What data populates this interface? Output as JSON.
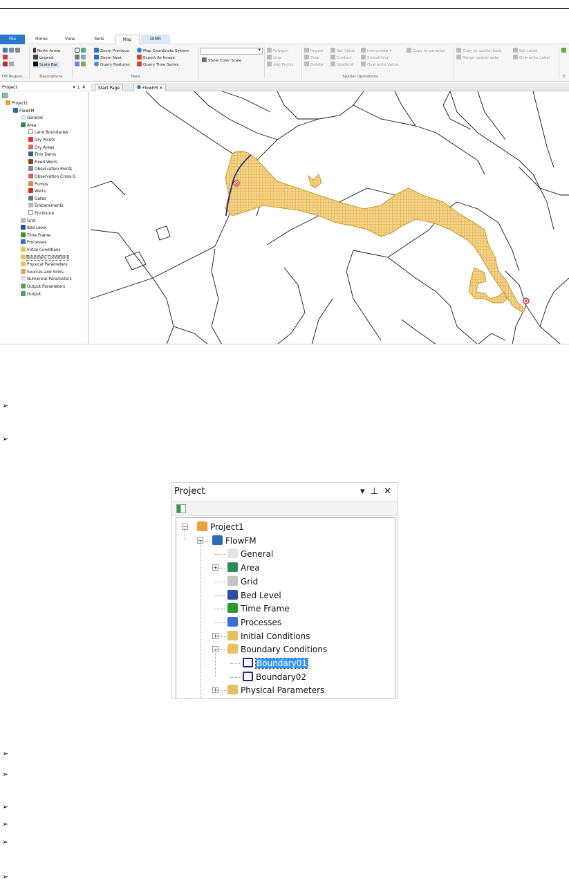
{
  "ribbon": {
    "tabs": [
      "File",
      "Home",
      "View",
      "Tools",
      "Map",
      "DIMR"
    ],
    "fm_region": {
      "buttons": [
        "...",
        "..."
      ],
      "label": "FM Region..."
    },
    "decorations": {
      "label": "Decorations",
      "items": [
        "North Arrow",
        "Legend",
        "Scale Bar"
      ]
    },
    "tools": {
      "label": "Tools",
      "items": [
        "Zoom Previous",
        "Zoom Next",
        "Query Features",
        "Map Coordinate System",
        "Export As Image",
        "Query Time Series"
      ]
    },
    "color_scale": {
      "combo_value": "",
      "button": "Show Color Scale"
    },
    "spatial": {
      "label": "Spatial Operations",
      "geom": [
        "Polygon",
        "Line",
        "Add Points"
      ],
      "edit": [
        "Import",
        "Crop",
        "Delete"
      ],
      "value": [
        "Set Value",
        "Contour",
        "Gradient"
      ],
      "interp": [
        "Interpolate ▾",
        "Smoothing",
        "Overwrite Value"
      ],
      "samples": [
        "Copy to samples"
      ],
      "spatialdata": [
        "Copy to spatial data",
        "Merge spatial data"
      ],
      "labels": [
        "Set Label",
        "Overwrite Label"
      ],
      "trailing": "E"
    }
  },
  "project_panel": {
    "title": "Project",
    "controls": "▾ ⊥ ✕",
    "tree": [
      "Project1",
      "FlowFM",
      "General",
      "Area",
      "Land Boundaries",
      "Dry Points",
      "Dry Areas",
      "Thin Dams",
      "Fixed Weirs",
      "Observation Points",
      "Observation Cross-S",
      "Pumps",
      "Weirs",
      "Gates",
      "Embankments",
      "Enclosure",
      "Grid",
      "Bed Level",
      "Time Frame",
      "Processes",
      "Initial Conditions",
      "Boundary Conditions",
      "Physical Parameters",
      "Sources and Sinks",
      "Numerical Parameters",
      "Output Parameters",
      "Output"
    ]
  },
  "document_tabs": [
    "Start Page",
    "FlowFM"
  ],
  "document_tab_close": "✕",
  "bullets": [
    "➢",
    "➢",
    "➢",
    "➢",
    "➢",
    "➢",
    "➢",
    "➢"
  ],
  "project_panel_zoom": {
    "title": "Project",
    "controls": "▾ ⊥ ✕",
    "tree": [
      "Project1",
      "FlowFM",
      "General",
      "Area",
      "Grid",
      "Bed Level",
      "Time Frame",
      "Processes",
      "Initial Conditions",
      "Boundary Conditions",
      "Boundary01",
      "Boundary02",
      "Physical Parameters"
    ]
  },
  "colors": {
    "file_tab": "#2a78c8",
    "grid_mesh": "#d99a1e",
    "boundary_line": "#1a2a8c",
    "selection": "#3399ff"
  }
}
